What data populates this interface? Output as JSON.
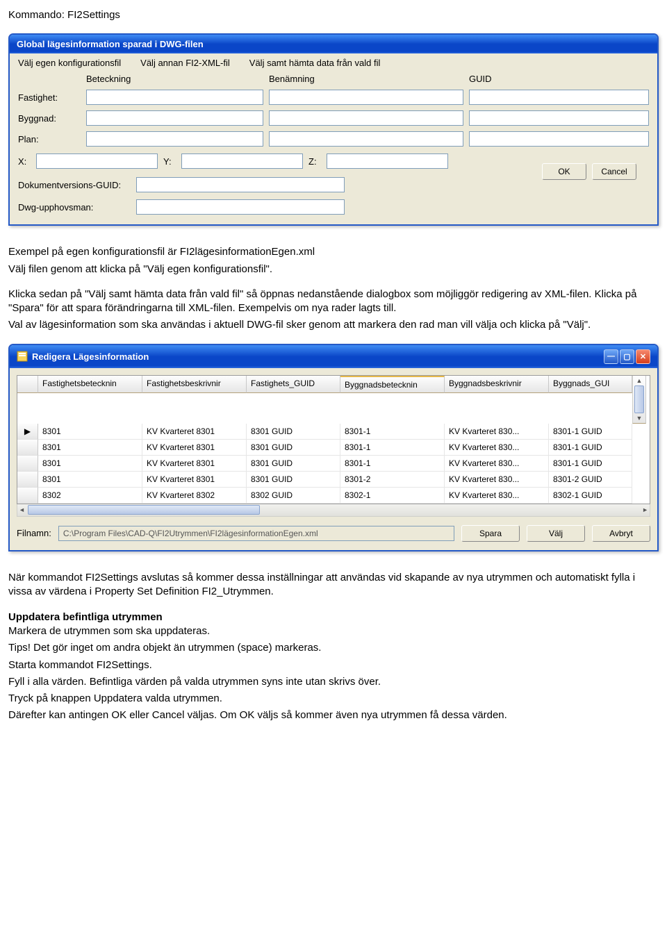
{
  "doc": {
    "command_line": "Kommando: FI2Settings",
    "example_par1": "Exempel på egen konfigurationsfil är FI2lägesinformationEgen.xml",
    "example_par2": "Välj filen genom att klicka på \"Välj egen konfigurationsfil\".",
    "example_par3": "Klicka sedan på \"Välj samt hämta data från vald fil\" så öppnas nedanstående dialogbox som möjliggör redigering av XML-filen. Klicka på \"Spara\" för att spara förändringarna till XML-filen. Exempelvis om nya rader lagts till.",
    "example_par4": "Val av lägesinformation som ska användas i aktuell DWG-fil sker genom att markera den rad man vill välja och klicka på \"Välj\".",
    "after_par1": "När kommandot FI2Settings avslutas så kommer dessa inställningar att användas vid skapande av nya utrymmen och automatiskt fylla i vissa av värdena i Property Set Definition FI2_Utrymmen.",
    "update_head": "Uppdatera befintliga utrymmen",
    "u1": "Markera de utrymmen som ska uppdateras.",
    "u2": "Tips! Det gör inget om andra objekt än utrymmen (space) markeras.",
    "u3": "Starta kommandot FI2Settings.",
    "u4": "Fyll i alla värden. Befintliga värden på valda utrymmen syns inte utan skrivs över.",
    "u5": "Tryck på knappen Uppdatera valda utrymmen.",
    "u6": "Därefter kan antingen OK eller Cancel väljas. Om OK väljs så kommer även nya utrymmen få dessa värden."
  },
  "dlg1": {
    "title": "Global lägesinformation sparad i DWG-filen",
    "menu": {
      "m1": "Välj egen konfigurationsfil",
      "m2": "Välj annan FI2-XML-fil",
      "m3": "Välj samt hämta data från vald fil"
    },
    "headers": {
      "beteckning": "Beteckning",
      "benamning": "Benämning",
      "guid": "GUID"
    },
    "rows": {
      "fastighet": "Fastighet:",
      "byggnad": "Byggnad:",
      "plan": "Plan:"
    },
    "xyz": {
      "x": "X:",
      "y": "Y:",
      "z": "Z:"
    },
    "docguid_label": "Dokumentversions-GUID:",
    "author_label": "Dwg-upphovsman:",
    "ok": "OK",
    "cancel": "Cancel"
  },
  "dlg2": {
    "title": "Redigera Lägesinformation",
    "columns": [
      "Fastighetsbetecknin",
      "Fastighetsbeskrivnir",
      "Fastighets_GUID",
      "Byggnadsbetecknin",
      "Byggnadsbeskrivnir",
      "Byggnads_GUI"
    ],
    "rows": [
      {
        "c0": "8301",
        "c1": "KV Kvarteret 8301",
        "c2": "8301 GUID",
        "c3": "8301-1",
        "c4": "KV Kvarteret 830...",
        "c5": "8301-1 GUID"
      },
      {
        "c0": "8301",
        "c1": "KV Kvarteret 8301",
        "c2": "8301 GUID",
        "c3": "8301-1",
        "c4": "KV Kvarteret 830...",
        "c5": "8301-1 GUID"
      },
      {
        "c0": "8301",
        "c1": "KV Kvarteret 8301",
        "c2": "8301 GUID",
        "c3": "8301-1",
        "c4": "KV Kvarteret 830...",
        "c5": "8301-1 GUID"
      },
      {
        "c0": "8301",
        "c1": "KV Kvarteret 8301",
        "c2": "8301 GUID",
        "c3": "8301-2",
        "c4": "KV Kvarteret 830...",
        "c5": "8301-2 GUID"
      },
      {
        "c0": "8302",
        "c1": "KV Kvarteret 8302",
        "c2": "8302 GUID",
        "c3": "8302-1",
        "c4": "KV Kvarteret 830...",
        "c5": "8302-1 GUID"
      }
    ],
    "filnamn_label": "Filnamn:",
    "filnamn_value": "C:\\Program Files\\CAD-Q\\FI2Utrymmen\\FI2lägesinformationEgen.xml",
    "btn_spara": "Spara",
    "btn_valj": "Välj",
    "btn_avbryt": "Avbryt"
  }
}
